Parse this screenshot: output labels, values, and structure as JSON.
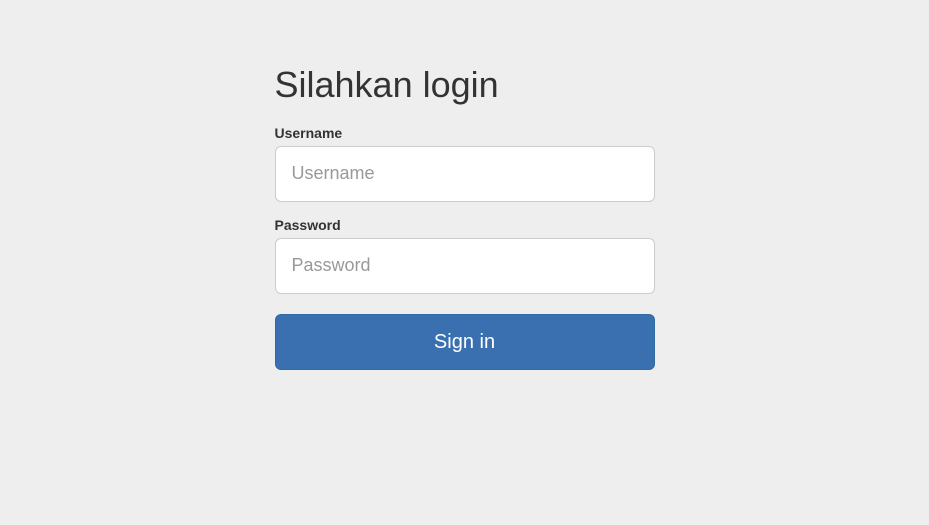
{
  "form": {
    "heading": "Silahkan login",
    "username": {
      "label": "Username",
      "placeholder": "Username",
      "value": ""
    },
    "password": {
      "label": "Password",
      "placeholder": "Password",
      "value": ""
    },
    "submit_label": "Sign in"
  }
}
